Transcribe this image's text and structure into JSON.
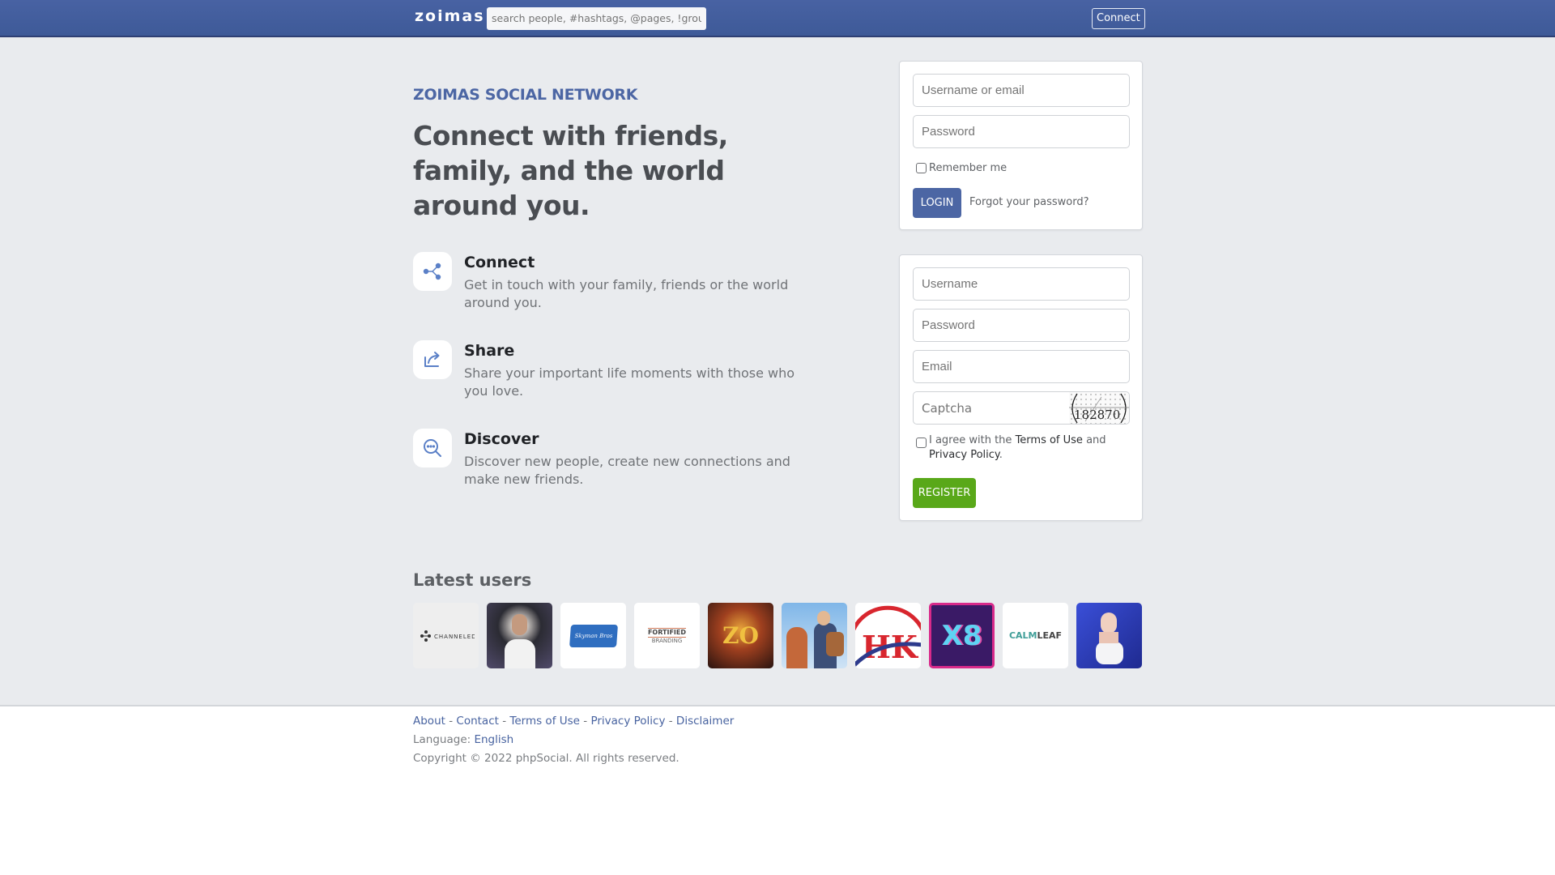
{
  "header": {
    "logo": "zoimas",
    "search_placeholder": "search people, #hashtags, @pages, !groups",
    "connect_label": "Connect"
  },
  "hero": {
    "brand": "ZOIMAS SOCIAL NETWORK",
    "headline": "Connect with friends, family, and the world around you."
  },
  "features": [
    {
      "icon": "share-nodes-icon",
      "title": "Connect",
      "description": "Get in touch with your family, friends or the world around you."
    },
    {
      "icon": "share-arrow-icon",
      "title": "Share",
      "description": "Share your important life moments with those who you love."
    },
    {
      "icon": "search-dots-icon",
      "title": "Discover",
      "description": "Discover new people, create new connections and make new friends."
    }
  ],
  "login": {
    "username_placeholder": "Username or email",
    "password_placeholder": "Password",
    "remember_label": "Remember me",
    "login_label": "LOGIN",
    "forgot_label": "Forgot your password?"
  },
  "register": {
    "username_placeholder": "Username",
    "password_placeholder": "Password",
    "email_placeholder": "Email",
    "captcha_placeholder": "Captcha",
    "captcha_code": "182870",
    "agree_prefix": "I agree with the",
    "terms_label": "Terms of Use",
    "and_text": "and",
    "privacy_label": "Privacy Policy",
    "period": ".",
    "register_label": "REGISTER"
  },
  "latest_users": {
    "title": "Latest users",
    "users": [
      {
        "name": "CHANNELED",
        "kind": "logo"
      },
      {
        "name": "man-in-white-shirt",
        "kind": "photo"
      },
      {
        "name": "Skyman Bros",
        "kind": "logo"
      },
      {
        "name": "FORTIFIED BRANDING",
        "kind": "logo"
      },
      {
        "name": "casino-zo",
        "kind": "photo"
      },
      {
        "name": "traveler-moscow",
        "kind": "photo"
      },
      {
        "name": "HK",
        "kind": "logo"
      },
      {
        "name": "X8",
        "kind": "logo"
      },
      {
        "name": "THE CALMLEAF",
        "kind": "logo"
      },
      {
        "name": "woman-portrait",
        "kind": "photo"
      }
    ]
  },
  "footer": {
    "links": [
      "About",
      "Contact",
      "Terms of Use",
      "Privacy Policy",
      "Disclaimer"
    ],
    "separator": " - ",
    "language_label": "Language:",
    "language_value": "English",
    "copyright": "Copyright © 2022 phpSocial. All rights reserved."
  },
  "colors": {
    "brand": "#4c66a4",
    "topbar": "#3e5a98",
    "register": "#59a819",
    "background": "#e9ebee"
  }
}
